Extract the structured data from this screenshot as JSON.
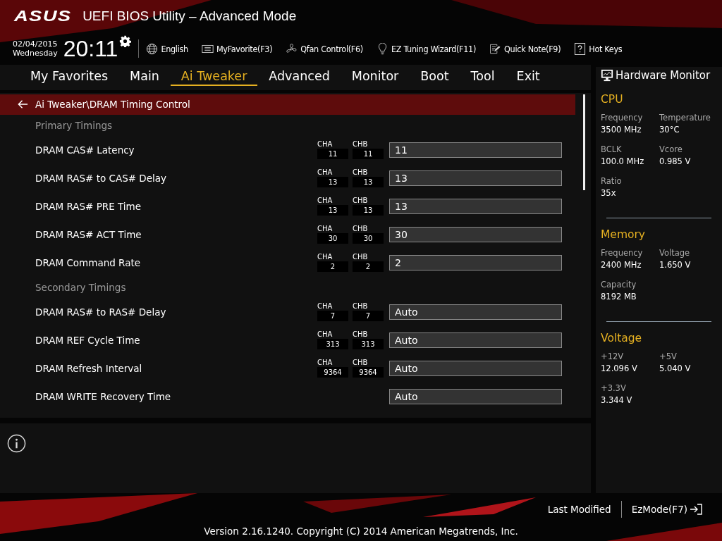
{
  "header": {
    "logo": "ASUS",
    "title": "UEFI BIOS Utility – Advanced Mode",
    "date": "02/04/2015",
    "weekday": "Wednesday",
    "time": "20:11"
  },
  "toolbar": [
    {
      "kind": "language",
      "label": "English"
    },
    {
      "kind": "favorites",
      "label": "MyFavorite(F3)"
    },
    {
      "kind": "qfan",
      "label": "Qfan Control(F6)"
    },
    {
      "kind": "wizard",
      "label": "EZ Tuning Wizard(F11)"
    },
    {
      "kind": "note",
      "label": "Quick Note(F9)"
    },
    {
      "kind": "hotkeys",
      "label": "Hot Keys"
    }
  ],
  "tabs": [
    {
      "label": "My Favorites",
      "selected": false
    },
    {
      "label": "Main",
      "selected": false
    },
    {
      "label": "Ai Tweaker",
      "selected": true
    },
    {
      "label": "Advanced",
      "selected": false
    },
    {
      "label": "Monitor",
      "selected": false
    },
    {
      "label": "Boot",
      "selected": false
    },
    {
      "label": "Tool",
      "selected": false
    },
    {
      "label": "Exit",
      "selected": false
    }
  ],
  "breadcrumb": "Ai Tweaker\\DRAM Timing Control",
  "rows": [
    {
      "kind": "header",
      "label": "Primary Timings"
    },
    {
      "kind": "setting",
      "label": "DRAM CAS# Latency",
      "cha_label": "CHA",
      "cha": "11",
      "chb_label": "CHB",
      "chb": "11",
      "value": "11"
    },
    {
      "kind": "setting",
      "label": "DRAM RAS# to CAS# Delay",
      "cha_label": "CHA",
      "cha": "13",
      "chb_label": "CHB",
      "chb": "13",
      "value": "13"
    },
    {
      "kind": "setting",
      "label": "DRAM RAS# PRE Time",
      "cha_label": "CHA",
      "cha": "13",
      "chb_label": "CHB",
      "chb": "13",
      "value": "13"
    },
    {
      "kind": "setting",
      "label": "DRAM RAS# ACT Time",
      "cha_label": "CHA",
      "cha": "30",
      "chb_label": "CHB",
      "chb": "30",
      "value": "30"
    },
    {
      "kind": "setting",
      "label": "DRAM Command Rate",
      "cha_label": "CHA",
      "cha": "2",
      "chb_label": "CHB",
      "chb": "2",
      "value": "2"
    },
    {
      "kind": "header",
      "label": "Secondary Timings"
    },
    {
      "kind": "setting",
      "label": "DRAM RAS# to RAS# Delay",
      "cha_label": "CHA",
      "cha": "7",
      "chb_label": "CHB",
      "chb": "7",
      "value": "Auto"
    },
    {
      "kind": "setting",
      "label": "DRAM REF Cycle Time",
      "cha_label": "CHA",
      "cha": "313",
      "chb_label": "CHB",
      "chb": "313",
      "value": "Auto"
    },
    {
      "kind": "setting",
      "label": "DRAM Refresh Interval",
      "cha_label": "CHA",
      "cha": "9364",
      "chb_label": "CHB",
      "chb": "9364",
      "value": "Auto"
    },
    {
      "kind": "setting",
      "label": "DRAM WRITE Recovery Time",
      "value": "Auto"
    }
  ],
  "hardware_monitor": {
    "title": "Hardware Monitor",
    "sections": [
      {
        "title": "CPU",
        "items": [
          {
            "label": "Frequency",
            "value": "3500 MHz"
          },
          {
            "label": "Temperature",
            "value": "30°C"
          },
          {
            "label": "BCLK",
            "value": "100.0 MHz"
          },
          {
            "label": "Vcore",
            "value": "0.985 V"
          },
          {
            "label": "Ratio",
            "value": "35x"
          }
        ]
      },
      {
        "title": "Memory",
        "items": [
          {
            "label": "Frequency",
            "value": "2400 MHz"
          },
          {
            "label": "Voltage",
            "value": "1.650 V"
          },
          {
            "label": "Capacity",
            "value": "8192 MB"
          }
        ]
      },
      {
        "title": "Voltage",
        "items": [
          {
            "label": "+12V",
            "value": "12.096 V"
          },
          {
            "label": "+5V",
            "value": "5.040 V"
          },
          {
            "label": "+3.3V",
            "value": "3.344 V"
          }
        ]
      }
    ]
  },
  "footer": {
    "last_modified": "Last Modified",
    "ezmode": "EzMode(F7)",
    "version": "Version 2.16.1240. Copyright (C) 2014 American Megatrends, Inc."
  }
}
